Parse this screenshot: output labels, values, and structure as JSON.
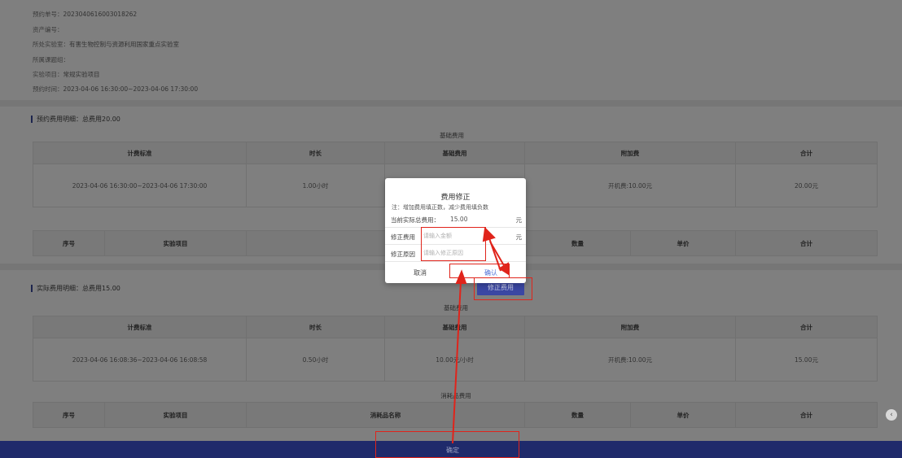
{
  "info": {
    "lines": [
      {
        "key": "预约单号：",
        "value": "2023040616003018262"
      },
      {
        "key": "资产编号：",
        "value": ""
      },
      {
        "key": "所处实验室：",
        "value": "有害生物控制与资源利用国家重点实验室"
      },
      {
        "key": "所属课题组：",
        "value": ""
      },
      {
        "key": "实验项目：",
        "value": "常规实验项目"
      },
      {
        "key": "预约时间：",
        "value": "2023-04-06 16:30:00~2023-04-06 17:30:00"
      }
    ]
  },
  "booking_fees": {
    "title": "预约费用明细：总费用20.00",
    "basic_caption": "基础费用",
    "headers": [
      "计费标准",
      "时长",
      "基础费用",
      "附加费",
      "合计"
    ],
    "row": [
      "2023-04-06 16:30:00~2023-04-06 17:30:00",
      "1.00小时",
      "",
      "开机费:10.00元",
      "20.00元"
    ],
    "consumable_headers": [
      "序号",
      "实验项目",
      "",
      "数量",
      "单价",
      "合计"
    ]
  },
  "actual_fees": {
    "title": "实际费用明细：总费用15.00",
    "modify_button": "修正费用",
    "basic_caption": "基础费用",
    "headers": [
      "计费标准",
      "时长",
      "基础费用",
      "附加费",
      "合计"
    ],
    "row": [
      "2023-04-06 16:08:36~2023-04-06 16:08:58",
      "0.50小时",
      "10.00元/小时",
      "开机费:10.00元",
      "15.00元"
    ],
    "consumable_caption": "消耗品费用",
    "consumable_headers": [
      "序号",
      "实验项目",
      "消耗品名称",
      "数量",
      "单价",
      "合计"
    ]
  },
  "footer": {
    "confirm_label": "确定"
  },
  "side_toggle_icon": "chevron-left-icon",
  "modal": {
    "title": "费用修正",
    "note": "注：增加费用填正数，减少费用填负数",
    "current_label": "当前实际总费用：",
    "current_value": "15.00",
    "unit": "元",
    "amount_label": "修正费用",
    "amount_placeholder": "请输入金额",
    "reason_label": "修正原因",
    "reason_placeholder": "请输入修正原因",
    "cancel_label": "取消",
    "confirm_label": "确认"
  },
  "colors": {
    "footer_bg": "#1f2a6b",
    "accent": "#3b47a3",
    "highlight": "#e0241b",
    "link": "#4f6fd6"
  }
}
